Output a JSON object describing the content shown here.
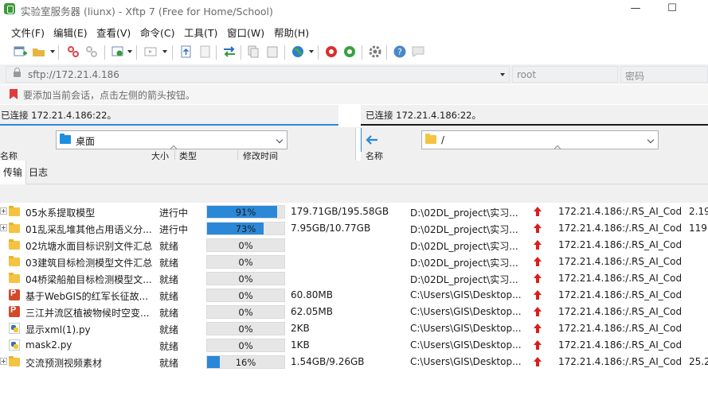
{
  "window": {
    "title": "实验室服务器 (liunx)   - Xftp 7 (Free for Home/School)",
    "minimize": "—",
    "maximize": "☐"
  },
  "menu": [
    "文件(F)",
    "编辑(E)",
    "查看(V)",
    "命令(C)",
    "工具(T)",
    "窗口(W)",
    "帮助(H)"
  ],
  "toolbar": {
    "icons": [
      "new-session-icon",
      "open-folder-icon",
      "disconnect-icon",
      "reconnect-icon",
      "transfer-options-icon",
      "preview-icon",
      "upload-icon",
      "download-icon",
      "sync-icon",
      "copy-icon",
      "paste-icon",
      "globe-icon",
      "xshell-icon",
      "xftp-icon",
      "settings-icon",
      "help-icon",
      "chat-icon"
    ]
  },
  "address": {
    "value": "sftp://172.21.4.186",
    "user_placeholder": "root",
    "password_placeholder": "密码"
  },
  "hint": "要添加当前会话，点击左侧的箭头按钮。",
  "left_pane": {
    "status": "已连接 172.21.4.186:22。",
    "path": "桌面",
    "columns": [
      "名称",
      "大小",
      "类型",
      "修改时间"
    ]
  },
  "right_pane": {
    "status": "已连接 172.21.4.186:22。",
    "path": "/",
    "columns": [
      "名称"
    ]
  },
  "tabs": [
    "传输",
    "日志"
  ],
  "transfers": [
    {
      "name": "05水系提取模型",
      "icon": "folder",
      "status": "进行中",
      "progress_pct": 91,
      "progress_label": "91%",
      "size": "179.71GB/195.58GB",
      "local": "D:\\02DL_project\\实习...",
      "remote": "172.21.4.186:/.RS_AI_Cod...",
      "extra": "2.19"
    },
    {
      "name": "01乱采乱堆其他占用语义分...",
      "icon": "folder",
      "status": "进行中",
      "progress_pct": 73,
      "progress_label": "73%",
      "size": "7.95GB/10.77GB",
      "local": "D:\\02DL_project\\实习...",
      "remote": "172.21.4.186:/.RS_AI_Cod...",
      "extra": "119."
    },
    {
      "name": "02坑塘水面目标识别文件汇总",
      "icon": "folder",
      "status": "就绪",
      "progress_pct": 0,
      "progress_label": "0%",
      "size": "",
      "local": "D:\\02DL_project\\实习...",
      "remote": "172.21.4.186:/.RS_AI_Cod...",
      "extra": ""
    },
    {
      "name": "03建筑目标检测模型文件汇总",
      "icon": "folder",
      "status": "就绪",
      "progress_pct": 0,
      "progress_label": "0%",
      "size": "",
      "local": "D:\\02DL_project\\实习...",
      "remote": "172.21.4.186:/.RS_AI_Cod...",
      "extra": ""
    },
    {
      "name": "04桥梁船舶目标检测模型文...",
      "icon": "folder",
      "status": "就绪",
      "progress_pct": 0,
      "progress_label": "0%",
      "size": "",
      "local": "D:\\02DL_project\\实习...",
      "remote": "172.21.4.186:/.RS_AI_Cod...",
      "extra": ""
    },
    {
      "name": "基于WebGIS的红军长征故...",
      "icon": "pptx",
      "status": "就绪",
      "progress_pct": 0,
      "progress_label": "0%",
      "size": "60.80MB",
      "local": "C:\\Users\\GIS\\Desktop...",
      "remote": "172.21.4.186:/.RS_AI_Cod...",
      "extra": ""
    },
    {
      "name": "三江并流区植被物候时空变...",
      "icon": "pptx",
      "status": "就绪",
      "progress_pct": 0,
      "progress_label": "0%",
      "size": "62.05MB",
      "local": "C:\\Users\\GIS\\Desktop...",
      "remote": "172.21.4.186:/.RS_AI_Cod...",
      "extra": ""
    },
    {
      "name": "显示xml(1).py",
      "icon": "py",
      "status": "就绪",
      "progress_pct": 0,
      "progress_label": "0%",
      "size": "2KB",
      "local": "C:\\Users\\GIS\\Desktop...",
      "remote": "172.21.4.186:/.RS_AI_Cod...",
      "extra": ""
    },
    {
      "name": "mask2.py",
      "icon": "py",
      "status": "就绪",
      "progress_pct": 0,
      "progress_label": "0%",
      "size": "1KB",
      "local": "C:\\Users\\GIS\\Desktop...",
      "remote": "172.21.4.186:/.RS_AI_Cod...",
      "extra": ""
    },
    {
      "name": "交流预测视频素材",
      "icon": "folder",
      "status": "就绪",
      "progress_pct": 16,
      "progress_label": "16%",
      "size": "1.54GB/9.26GB",
      "local": "C:\\Users\\GIS\\Desktop...",
      "remote": "172.21.4.186:/.RS_AI_Cod...",
      "extra": "25.2"
    }
  ],
  "colors": {
    "progress_fill": "#2b88d8",
    "upload_arrow": "#d61f1f",
    "status_line": "#2b88d8"
  }
}
